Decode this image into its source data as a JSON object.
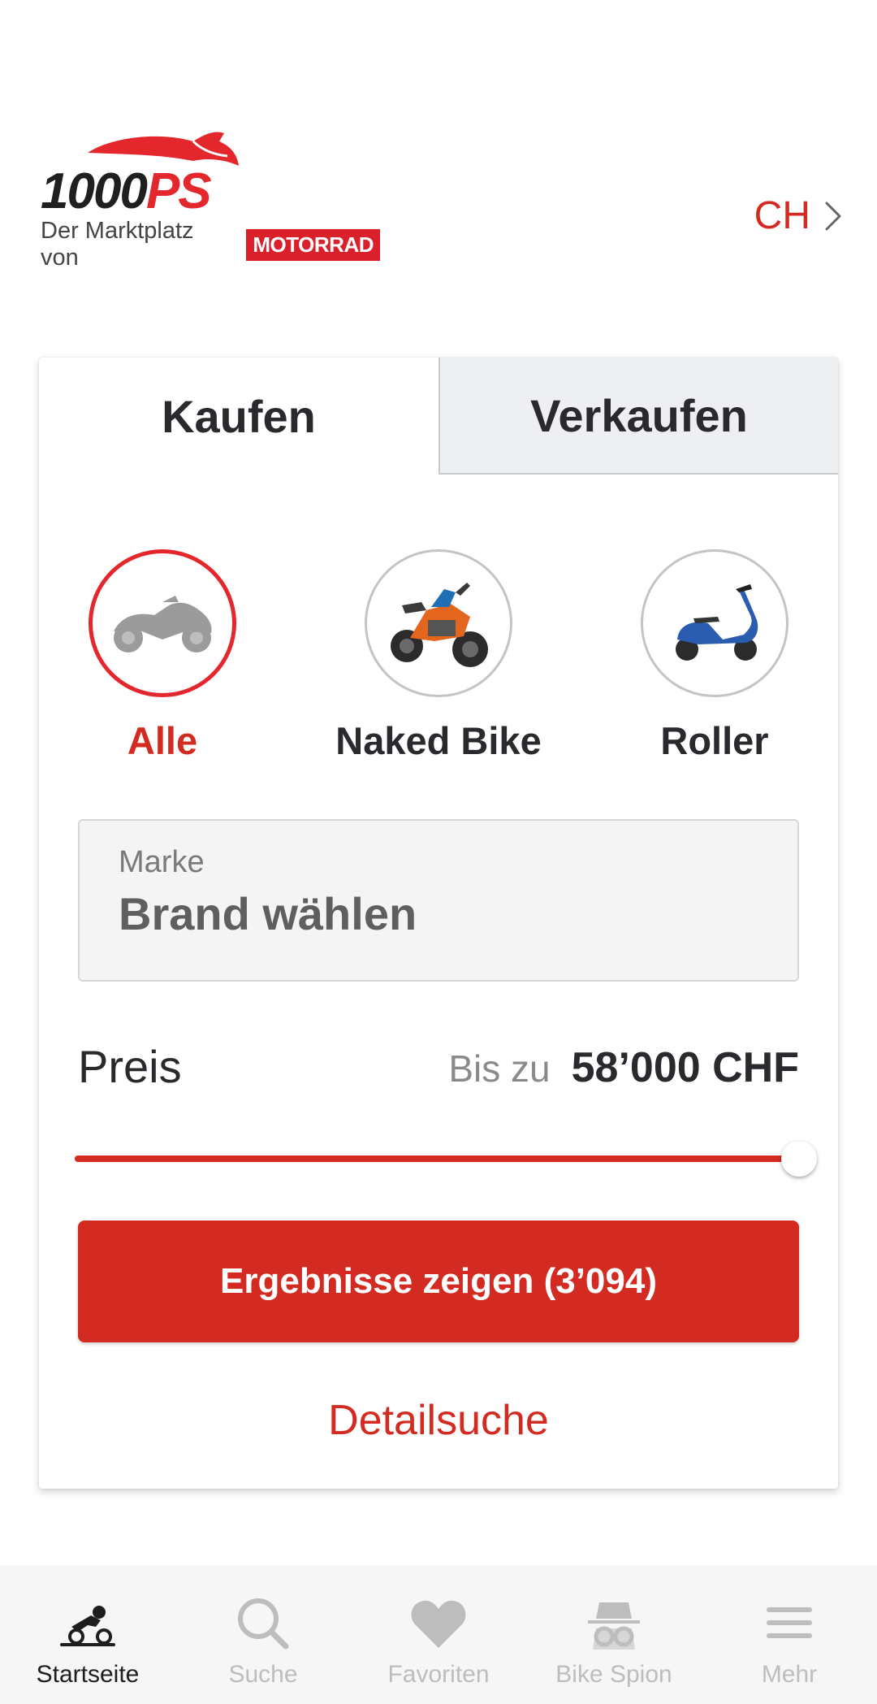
{
  "header": {
    "logo_text": "1000PS",
    "logo_subtitle": "Der Marktplatz von",
    "logo_brand": "MOTORRAD",
    "country": "CH"
  },
  "tabs": [
    {
      "label": "Kaufen",
      "active": true
    },
    {
      "label": "Verkaufen",
      "active": false
    }
  ],
  "categories": [
    {
      "label": "Alle",
      "icon": "motorcycle-silhouette-icon",
      "active": true
    },
    {
      "label": "Naked Bike",
      "icon": "naked-bike-icon",
      "active": false
    },
    {
      "label": "Roller",
      "icon": "scooter-icon",
      "active": false
    }
  ],
  "brand_field": {
    "label": "Marke",
    "value": "Brand wählen"
  },
  "price": {
    "label": "Preis",
    "upto_label": "Bis zu",
    "value": "58’000 CHF",
    "slider_fraction": 1.0
  },
  "results_button": "Ergebnisse zeigen (3’094)",
  "detail_link": "Detailsuche",
  "bottom_nav": [
    {
      "label": "Startseite",
      "icon": "rider-icon",
      "active": true
    },
    {
      "label": "Suche",
      "icon": "search-icon",
      "active": false
    },
    {
      "label": "Favoriten",
      "icon": "heart-icon",
      "active": false
    },
    {
      "label": "Bike Spion",
      "icon": "spy-icon",
      "active": false
    },
    {
      "label": "Mehr",
      "icon": "menu-icon",
      "active": false
    }
  ],
  "colors": {
    "accent": "#d32b21",
    "logo_red": "#e4262d",
    "text_dark": "#2a2a2e",
    "nav_inactive": "#bdbdbd"
  }
}
